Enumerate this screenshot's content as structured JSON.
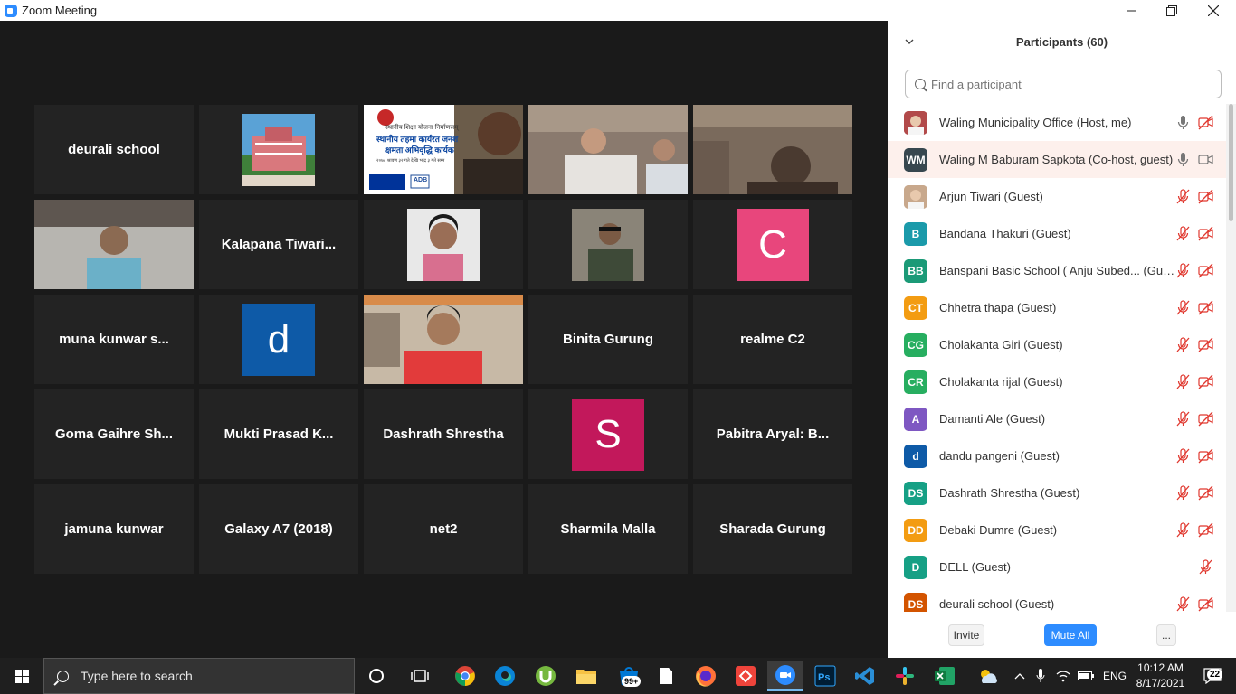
{
  "window": {
    "title": "Zoom Meeting",
    "minimize": "—",
    "restore": "❐",
    "close": "✕"
  },
  "video_tiles": [
    {
      "name": "deurali school",
      "kind": "name"
    },
    {
      "name": "",
      "kind": "photo-school"
    },
    {
      "name": "",
      "kind": "photo-banner",
      "active": true
    },
    {
      "name": "",
      "kind": "photo-room"
    },
    {
      "name": "",
      "kind": "photo-room2"
    },
    {
      "name": "",
      "kind": "photo-woman"
    },
    {
      "name": "Kalapana  Tiwari...",
      "kind": "name"
    },
    {
      "name": "",
      "kind": "photo-woman2"
    },
    {
      "name": "",
      "kind": "photo-man"
    },
    {
      "name": "C",
      "kind": "letter",
      "color": "#e8467c"
    },
    {
      "name": "muna kunwar s...",
      "kind": "name"
    },
    {
      "name": "d",
      "kind": "letter",
      "color": "#0e5aa7"
    },
    {
      "name": "",
      "kind": "photo-red"
    },
    {
      "name": "Binita Gurung",
      "kind": "name"
    },
    {
      "name": "realme C2",
      "kind": "name"
    },
    {
      "name": "Goma Gaihre Sh...",
      "kind": "name"
    },
    {
      "name": "Mukti  Prasad  K...",
      "kind": "name"
    },
    {
      "name": "Dashrath Shrestha",
      "kind": "name"
    },
    {
      "name": "S",
      "kind": "letter",
      "color": "#c2185b"
    },
    {
      "name": "Pabitra Aryal: B...",
      "kind": "name"
    },
    {
      "name": "jamuna kunwar",
      "kind": "name"
    },
    {
      "name": "Galaxy A7 (2018)",
      "kind": "name"
    },
    {
      "name": "net2",
      "kind": "name"
    },
    {
      "name": "Sharmila Malla",
      "kind": "name"
    },
    {
      "name": "Sharada Gurung",
      "kind": "name"
    }
  ],
  "banner": {
    "line1": "स्थानीय शिक्षा योजना निर्माणसम्",
    "line2": "स्थानीय तहमा कार्यरत जनश",
    "line3": "क्षमता अभिवृद्धि कार्यक",
    "sub": "२०७८ श्रावण ३२ गते देखि भाद्र ३ गते सम्म",
    "logo": "ADB"
  },
  "participants_panel": {
    "title": "Participants (60)",
    "search_placeholder": "Find a participant",
    "participants": [
      {
        "initials": "",
        "name": "Waling Municipality Office (Host, me)",
        "color": "#b24a4a",
        "mic": "on",
        "video": "off",
        "highlight": false
      },
      {
        "initials": "WM",
        "name": "Waling M Baburam Sapkota (Co-host, guest)",
        "color": "#37474f",
        "mic": "on",
        "video": "on",
        "highlight": true
      },
      {
        "initials": "",
        "name": "Arjun Tiwari (Guest)",
        "color": "#c8a88c",
        "mic": "off",
        "video": "off",
        "highlight": false
      },
      {
        "initials": "B",
        "name": "Bandana Thakuri (Guest)",
        "color": "#1b9aaa",
        "mic": "off",
        "video": "off",
        "highlight": false
      },
      {
        "initials": "BB",
        "name": "Banspani Basic School ( Anju Subed... (Guest)",
        "color": "#1b9a77",
        "mic": "off",
        "video": "off",
        "highlight": false
      },
      {
        "initials": "CT",
        "name": "Chhetra thapa (Guest)",
        "color": "#f39c12",
        "mic": "off",
        "video": "off",
        "highlight": false
      },
      {
        "initials": "CG",
        "name": "Cholakanta Giri (Guest)",
        "color": "#27ae60",
        "mic": "off",
        "video": "off",
        "highlight": false
      },
      {
        "initials": "CR",
        "name": "Cholakanta rijal (Guest)",
        "color": "#27ae60",
        "mic": "off",
        "video": "off",
        "highlight": false
      },
      {
        "initials": "A",
        "name": "Damanti Ale (Guest)",
        "color": "#7e57c2",
        "mic": "off",
        "video": "off",
        "highlight": false
      },
      {
        "initials": "d",
        "name": "dandu pangeni (Guest)",
        "color": "#0e5aa7",
        "mic": "off",
        "video": "off",
        "highlight": false
      },
      {
        "initials": "DS",
        "name": "Dashrath Shrestha (Guest)",
        "color": "#16a085",
        "mic": "off",
        "video": "off",
        "highlight": false
      },
      {
        "initials": "DD",
        "name": "Debaki Dumre (Guest)",
        "color": "#f39c12",
        "mic": "off",
        "video": "off",
        "highlight": false
      },
      {
        "initials": "D",
        "name": "DELL (Guest)",
        "color": "#16a085",
        "mic": "off",
        "video": "none",
        "highlight": false
      },
      {
        "initials": "DS",
        "name": "deurali school (Guest)",
        "color": "#d35400",
        "mic": "off",
        "video": "off",
        "highlight": false
      }
    ],
    "invite_label": "Invite",
    "mute_all_label": "Mute All",
    "more_label": "..."
  },
  "taskbar": {
    "search_placeholder": "Type here to search",
    "store_badge": "99+",
    "language": "ENG",
    "time": "10:12 AM",
    "date": "8/17/2021",
    "notification_count": "22"
  },
  "colors": {
    "zoom_blue": "#2d8cff",
    "mute_red": "#e0382f",
    "tile_bg": "#232323",
    "active_speaker": "#e6e62d"
  }
}
